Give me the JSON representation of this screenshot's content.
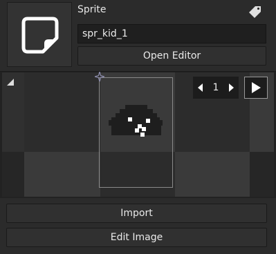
{
  "sprite": {
    "label": "Sprite",
    "name_value": "spr_kid_1",
    "open_editor_label": "Open Editor"
  },
  "preview": {
    "frame_number": "1"
  },
  "actions": {
    "import_label": "Import",
    "edit_image_label": "Edit Image"
  },
  "icons": {
    "thumbnail": "sprite-icon",
    "tag": "tag-icon",
    "origin": "origin-crosshair-icon",
    "collapse": "triangle-corner-icon",
    "prev": "chevron-left-icon",
    "next": "chevron-right-icon",
    "play": "play-icon"
  },
  "colors": {
    "panel": "#2b2b2b",
    "field": "#1f1f1f",
    "button": "#303030",
    "checker_light": "#3a3a3a",
    "checker_dark": "#2c2c2c",
    "frame_border": "#8a8a8a",
    "origin": "#8a8aa8"
  }
}
